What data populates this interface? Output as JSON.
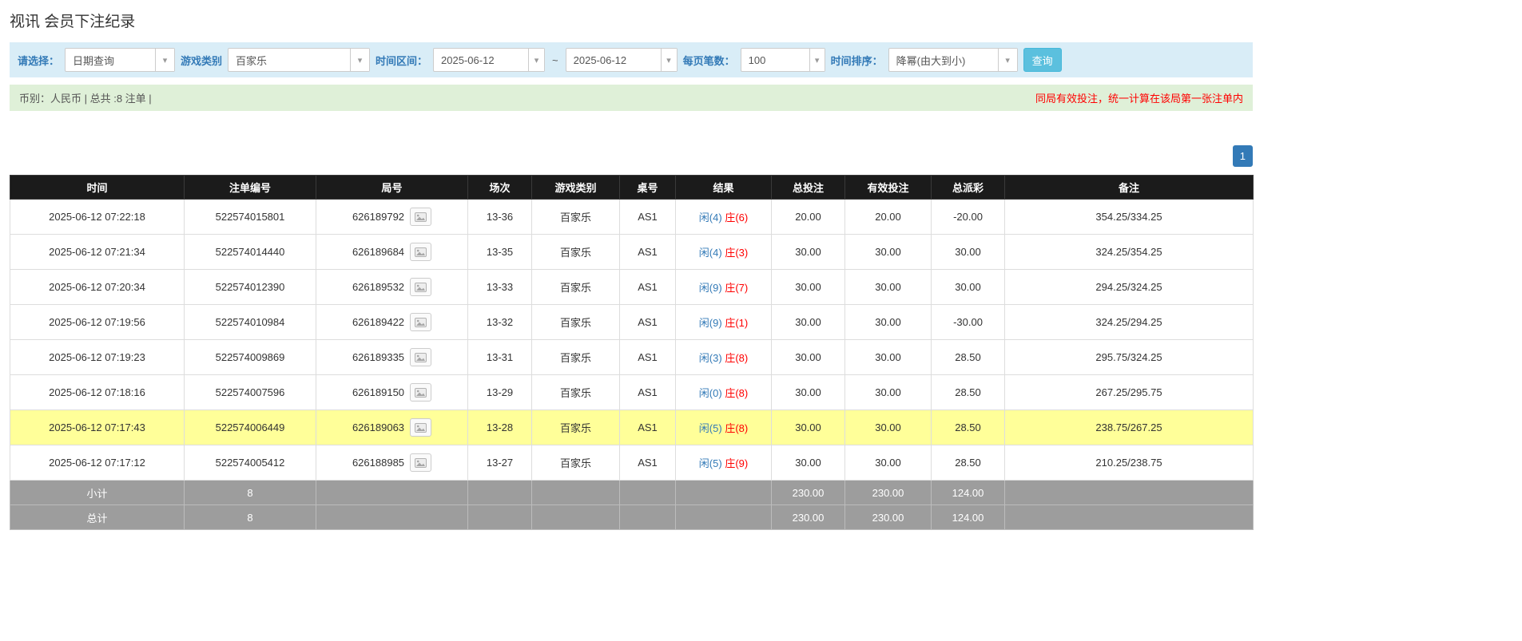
{
  "page": {
    "title": "视讯 会员下注纪录"
  },
  "colors": {
    "accent_blue": "#337ab7",
    "button_cyan": "#5bc0de",
    "filter_bar_bg": "#d9edf7",
    "summary_bar_bg": "#dff0d8",
    "warning_red": "#ff0000",
    "highlight_yellow": "#ffff99",
    "table_header_black": "#1b1b1b",
    "footer_gray": "#9d9d9d",
    "player_blue": "#337ab7",
    "banker_red": "#ff0000"
  },
  "icons": {
    "caret_down": "▾",
    "round_preview": "image-icon"
  },
  "filter": {
    "select_label": "请选择：",
    "select_value": "日期查询",
    "game_type_label": "游戏类别",
    "game_type_value": "百家乐",
    "date_range_label": "时间区间：",
    "date_from": "2025-06-12",
    "date_tilde": "~",
    "date_to": "2025-06-12",
    "per_page_label": "每页笔数：",
    "per_page_value": "100",
    "sort_label": "时间排序：",
    "sort_value": "降幂(由大到小)",
    "query_button": "查询"
  },
  "summary": {
    "left": "币别：人民币 | 总共 :8 注单 |",
    "right": "同局有效投注，统一计算在该局第一张注单内"
  },
  "pagination": {
    "current": "1"
  },
  "table": {
    "headers": [
      "时间",
      "注单编号",
      "局号",
      "场次",
      "游戏类别",
      "桌号",
      "结果",
      "总投注",
      "有效投注",
      "总派彩",
      "备注"
    ],
    "rows": [
      {
        "time": "2025-06-12 07:22:18",
        "bet_id": "522574015801",
        "round_id": "626189792",
        "session": "13-36",
        "game": "百家乐",
        "table_no": "AS1",
        "result_player": "闲(4)",
        "result_banker": "庄(6)",
        "total_bet": "20.00",
        "valid_bet": "20.00",
        "payout": "-20.00",
        "note": "354.25/334.25",
        "highlighted": false
      },
      {
        "time": "2025-06-12 07:21:34",
        "bet_id": "522574014440",
        "round_id": "626189684",
        "session": "13-35",
        "game": "百家乐",
        "table_no": "AS1",
        "result_player": "闲(4)",
        "result_banker": "庄(3)",
        "total_bet": "30.00",
        "valid_bet": "30.00",
        "payout": "30.00",
        "note": "324.25/354.25",
        "highlighted": false
      },
      {
        "time": "2025-06-12 07:20:34",
        "bet_id": "522574012390",
        "round_id": "626189532",
        "session": "13-33",
        "game": "百家乐",
        "table_no": "AS1",
        "result_player": "闲(9)",
        "result_banker": "庄(7)",
        "total_bet": "30.00",
        "valid_bet": "30.00",
        "payout": "30.00",
        "note": "294.25/324.25",
        "highlighted": false
      },
      {
        "time": "2025-06-12 07:19:56",
        "bet_id": "522574010984",
        "round_id": "626189422",
        "session": "13-32",
        "game": "百家乐",
        "table_no": "AS1",
        "result_player": "闲(9)",
        "result_banker": "庄(1)",
        "total_bet": "30.00",
        "valid_bet": "30.00",
        "payout": "-30.00",
        "note": "324.25/294.25",
        "highlighted": false
      },
      {
        "time": "2025-06-12 07:19:23",
        "bet_id": "522574009869",
        "round_id": "626189335",
        "session": "13-31",
        "game": "百家乐",
        "table_no": "AS1",
        "result_player": "闲(3)",
        "result_banker": "庄(8)",
        "total_bet": "30.00",
        "valid_bet": "30.00",
        "payout": "28.50",
        "note": "295.75/324.25",
        "highlighted": false
      },
      {
        "time": "2025-06-12 07:18:16",
        "bet_id": "522574007596",
        "round_id": "626189150",
        "session": "13-29",
        "game": "百家乐",
        "table_no": "AS1",
        "result_player": "闲(0)",
        "result_banker": "庄(8)",
        "total_bet": "30.00",
        "valid_bet": "30.00",
        "payout": "28.50",
        "note": "267.25/295.75",
        "highlighted": false
      },
      {
        "time": "2025-06-12 07:17:43",
        "bet_id": "522574006449",
        "round_id": "626189063",
        "session": "13-28",
        "game": "百家乐",
        "table_no": "AS1",
        "result_player": "闲(5)",
        "result_banker": "庄(8)",
        "total_bet": "30.00",
        "valid_bet": "30.00",
        "payout": "28.50",
        "note": "238.75/267.25",
        "highlighted": true
      },
      {
        "time": "2025-06-12 07:17:12",
        "bet_id": "522574005412",
        "round_id": "626188985",
        "session": "13-27",
        "game": "百家乐",
        "table_no": "AS1",
        "result_player": "闲(5)",
        "result_banker": "庄(9)",
        "total_bet": "30.00",
        "valid_bet": "30.00",
        "payout": "28.50",
        "note": "210.25/238.75",
        "highlighted": false
      }
    ],
    "subtotal": {
      "label": "小计",
      "count": "8",
      "total_bet": "230.00",
      "valid_bet": "230.00",
      "payout": "124.00"
    },
    "total": {
      "label": "总计",
      "count": "8",
      "total_bet": "230.00",
      "valid_bet": "230.00",
      "payout": "124.00"
    }
  }
}
